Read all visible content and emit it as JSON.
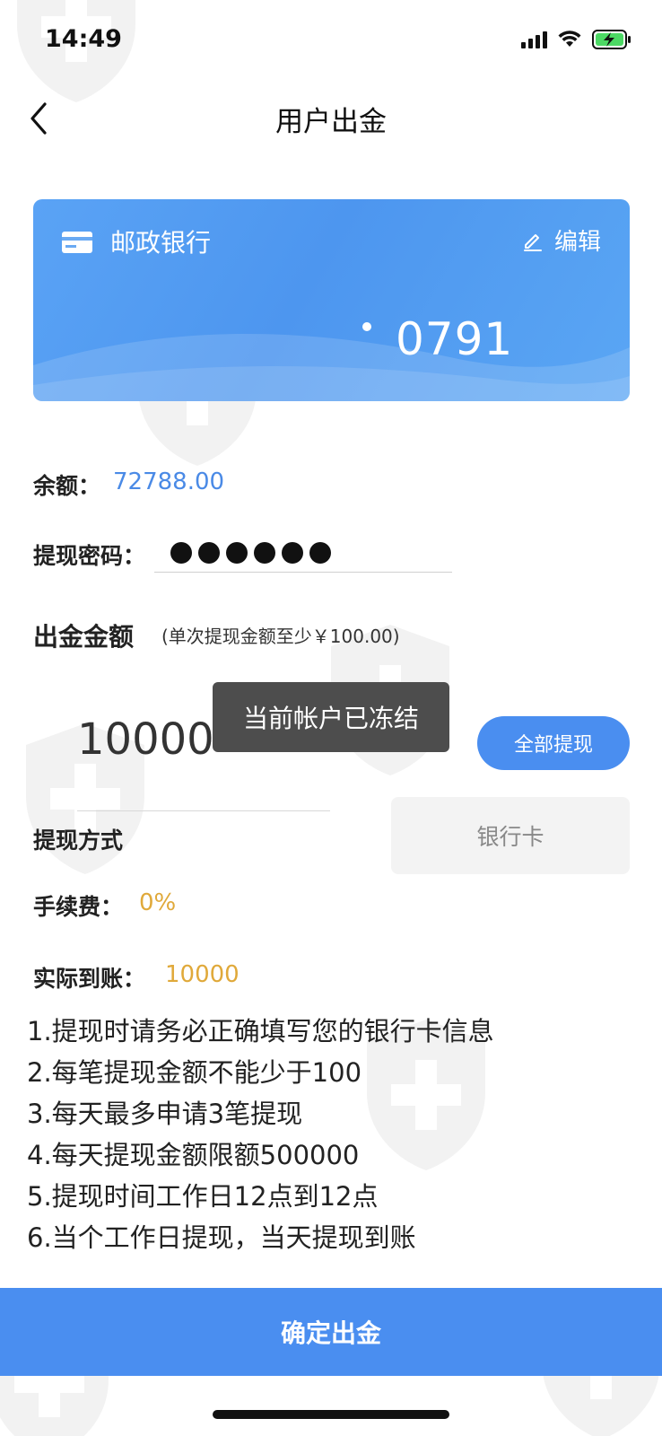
{
  "status_bar": {
    "time": "14:49"
  },
  "nav": {
    "title": "用户出金"
  },
  "card": {
    "bank_name": "邮政银行",
    "edit_label": "编辑",
    "last4": "0791"
  },
  "balance": {
    "label": "余额：",
    "value": "72788.00"
  },
  "password": {
    "label": "提现密码：",
    "masked_length": 6
  },
  "amount": {
    "label": "出金金额",
    "hint": "(单次提现金额至少￥100.00)",
    "value": "10000",
    "all_button_label": "全部提现"
  },
  "toast": {
    "text": "当前帐户已冻结"
  },
  "method": {
    "label": "提现方式",
    "value": "银行卡"
  },
  "fee": {
    "label": "手续费：",
    "value": "0%"
  },
  "actual": {
    "label": "实际到账：",
    "value": "10000"
  },
  "rules": [
    "1.提现时请务必正确填写您的银行卡信息",
    "2.每笔提现金额不能少于100",
    "3.每天最多申请3笔提现",
    "4.每天提现金额限额500000",
    "5.提现时间工作日12点到12点",
    "6.当个工作日提现，当天提现到账"
  ],
  "confirm_button": {
    "label": "确定出金"
  },
  "colors": {
    "accent": "#4a8ef0",
    "balance_text": "#4a8ae6",
    "highlight_text": "#e0a93a",
    "toast_bg": "#4d4d4d"
  }
}
